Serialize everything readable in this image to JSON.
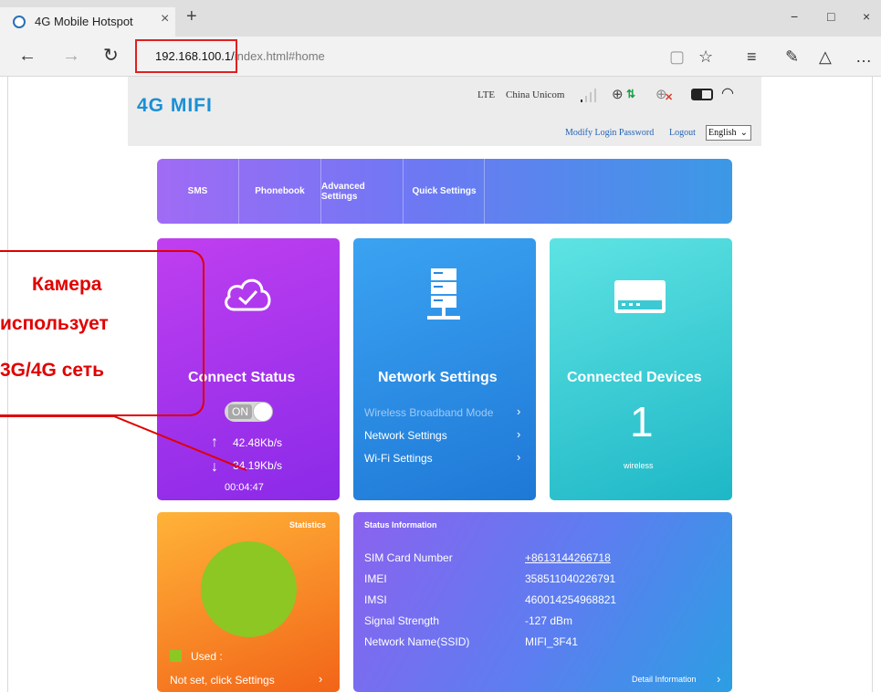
{
  "browser": {
    "tab_title": "4G Mobile Hotspot",
    "tab_close": "×",
    "new_tab": "+",
    "minimize": "−",
    "maximize": "□",
    "close": "×",
    "back": "←",
    "forward": "→",
    "refresh": "↻",
    "address_host": "192.168.100.1/",
    "address_path": "index.html#home",
    "reading_view_icon": "▢",
    "favorite_icon": "☆",
    "hub_icon": "≡",
    "note_icon": "✎",
    "share_icon": "△",
    "more_icon": "…"
  },
  "header": {
    "logo": "4G MIFI",
    "network_type": "LTE",
    "carrier": "China Unicom",
    "signal_bars": 1,
    "modify_password": "Modify Login Password",
    "logout": "Logout",
    "language": "English"
  },
  "menu": {
    "items": [
      "SMS",
      "Phonebook",
      "Advanced Settings",
      "Quick Settings"
    ]
  },
  "connect": {
    "title": "Connect Status",
    "toggle": "ON",
    "upload": "42.48Kb/s",
    "download": "34.19Kb/s",
    "uptime": "00:04:47"
  },
  "network": {
    "title": "Network Settings",
    "links": [
      "Wireless Broadband Mode",
      "Network Settings",
      "Wi-Fi Settings"
    ],
    "chevron": "›"
  },
  "devices": {
    "title": "Connected Devices",
    "count": "1",
    "type": "wireless"
  },
  "stats": {
    "title": "Statistics",
    "used_label": "Used  :",
    "not_set": "Not set, click Settings",
    "pie_color": "#8cc723"
  },
  "status": {
    "title": "Status Information",
    "rows": [
      {
        "label": "SIM Card Number",
        "value": "+8613144266718"
      },
      {
        "label": "IMEI",
        "value": "358511040226791"
      },
      {
        "label": "IMSI",
        "value": "460014254968821"
      },
      {
        "label": "Signal Strength",
        "value": "-127 dBm"
      },
      {
        "label": "Network Name(SSID)",
        "value": "MIFI_3F41"
      }
    ],
    "detail": "Detail Information"
  },
  "annotation": {
    "line1": "Камера",
    "line2": "использует",
    "line3": "3G/4G сеть",
    "color": "#e00000"
  }
}
